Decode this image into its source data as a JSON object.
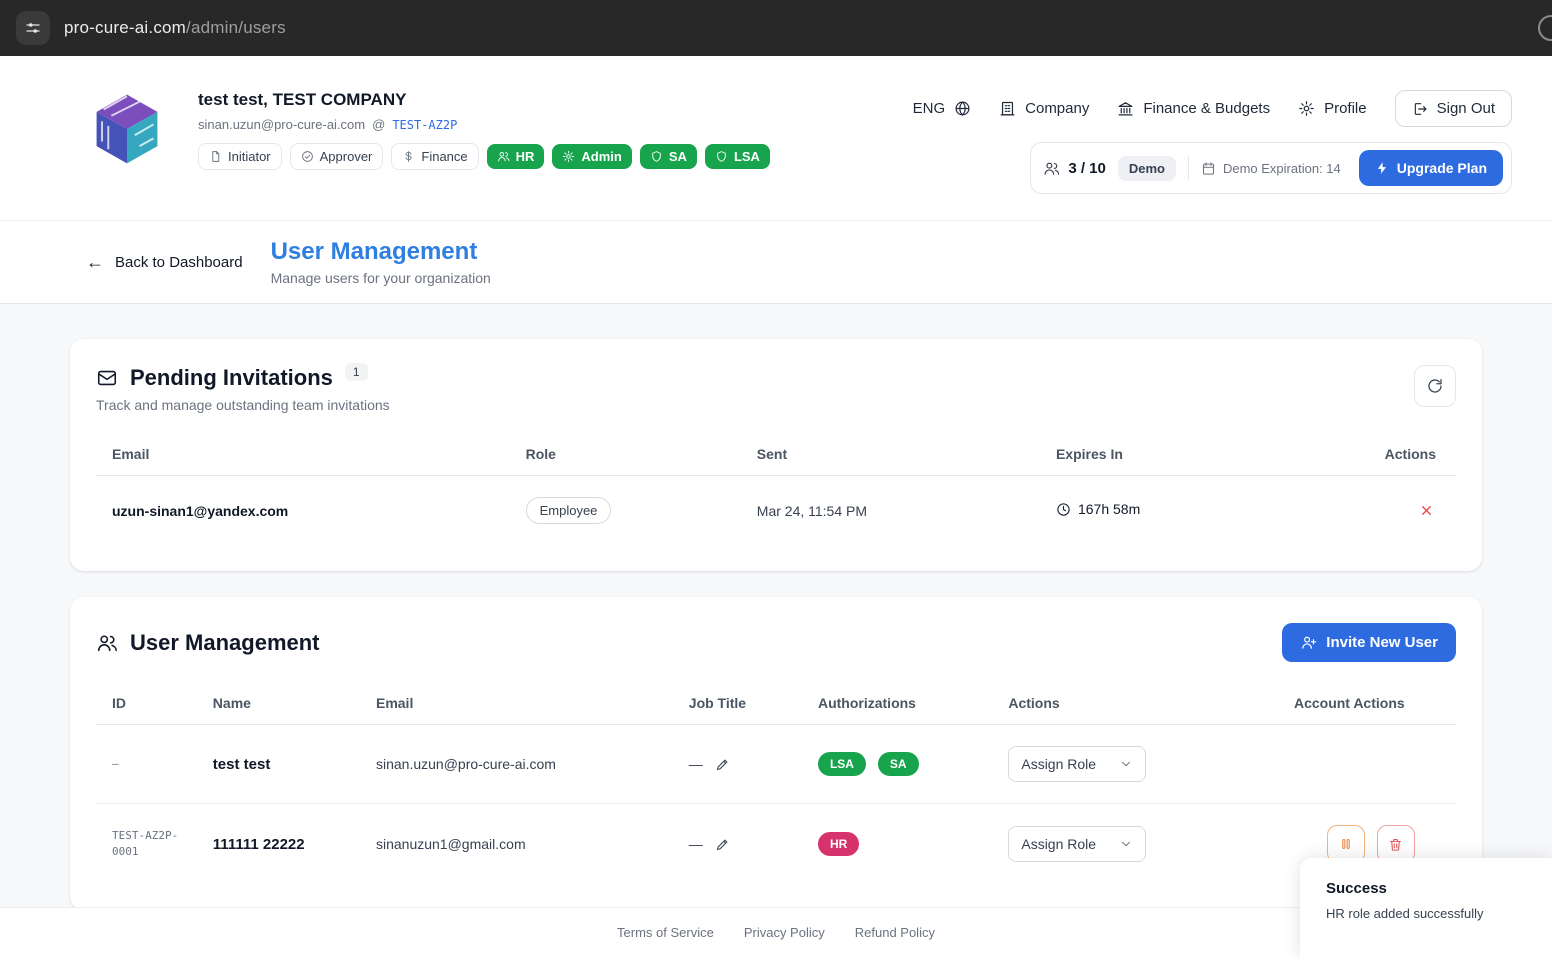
{
  "browser": {
    "url_host": "pro-cure-ai.com",
    "url_path": "/admin/users"
  },
  "header": {
    "company_title": "test test, TEST COMPANY",
    "email": "sinan.uzun@pro-cure-ai.com",
    "at_sep": "@",
    "tenant": "TEST-AZ2P",
    "badges_outline": [
      {
        "label": "Initiator"
      },
      {
        "label": "Approver"
      },
      {
        "label": "Finance"
      }
    ],
    "badges_green": [
      {
        "label": "HR"
      },
      {
        "label": "Admin"
      },
      {
        "label": "SA"
      },
      {
        "label": "LSA"
      }
    ],
    "nav": {
      "lang": "ENG",
      "company": "Company",
      "finance": "Finance & Budgets",
      "profile": "Profile",
      "sign_out": "Sign Out"
    },
    "plan": {
      "usage": "3 / 10",
      "badge": "Demo",
      "expiration": "Demo Expiration: 14",
      "upgrade": "Upgrade Plan"
    }
  },
  "subheader": {
    "back": "Back to Dashboard",
    "title": "User Management",
    "subtitle": "Manage users for your organization"
  },
  "pending": {
    "title": "Pending Invitations",
    "count": "1",
    "subtitle": "Track and manage outstanding team invitations",
    "columns": [
      "Email",
      "Role",
      "Sent",
      "Expires In",
      "Actions"
    ],
    "rows": [
      {
        "email": "uzun-sinan1@yandex.com",
        "role": "Employee",
        "sent": "Mar 24, 11:54 PM",
        "expires": "167h 58m"
      }
    ]
  },
  "users": {
    "title": "User Management",
    "invite": "Invite New User",
    "columns": [
      "ID",
      "Name",
      "Email",
      "Job Title",
      "Authorizations",
      "Actions",
      "Account Actions"
    ],
    "rows": [
      {
        "id": "–",
        "name": "test test",
        "email": "sinan.uzun@pro-cure-ai.com",
        "job": "—",
        "auths": [
          {
            "label": "LSA"
          },
          {
            "label": "SA"
          }
        ],
        "action": "Assign Role"
      },
      {
        "id": "TEST-AZ2P-0001",
        "name": "111111 22222",
        "email": "sinanuzun1@gmail.com",
        "job": "—",
        "auths": [
          {
            "label": "HR"
          }
        ],
        "action": "Assign Role"
      }
    ]
  },
  "footer": {
    "links": [
      "Terms of Service",
      "Privacy Policy",
      "Refund Policy"
    ]
  },
  "toast": {
    "title": "Success",
    "message": "HR role added successfully"
  },
  "colors": {
    "accent_blue": "#2e6be0",
    "title_blue": "#2f7fe0",
    "badge_green": "#18a44c",
    "badge_pink": "#d6336c",
    "danger_red": "#ef4444",
    "browser_bar": "#282828",
    "page_bg": "#f7f8fa"
  }
}
